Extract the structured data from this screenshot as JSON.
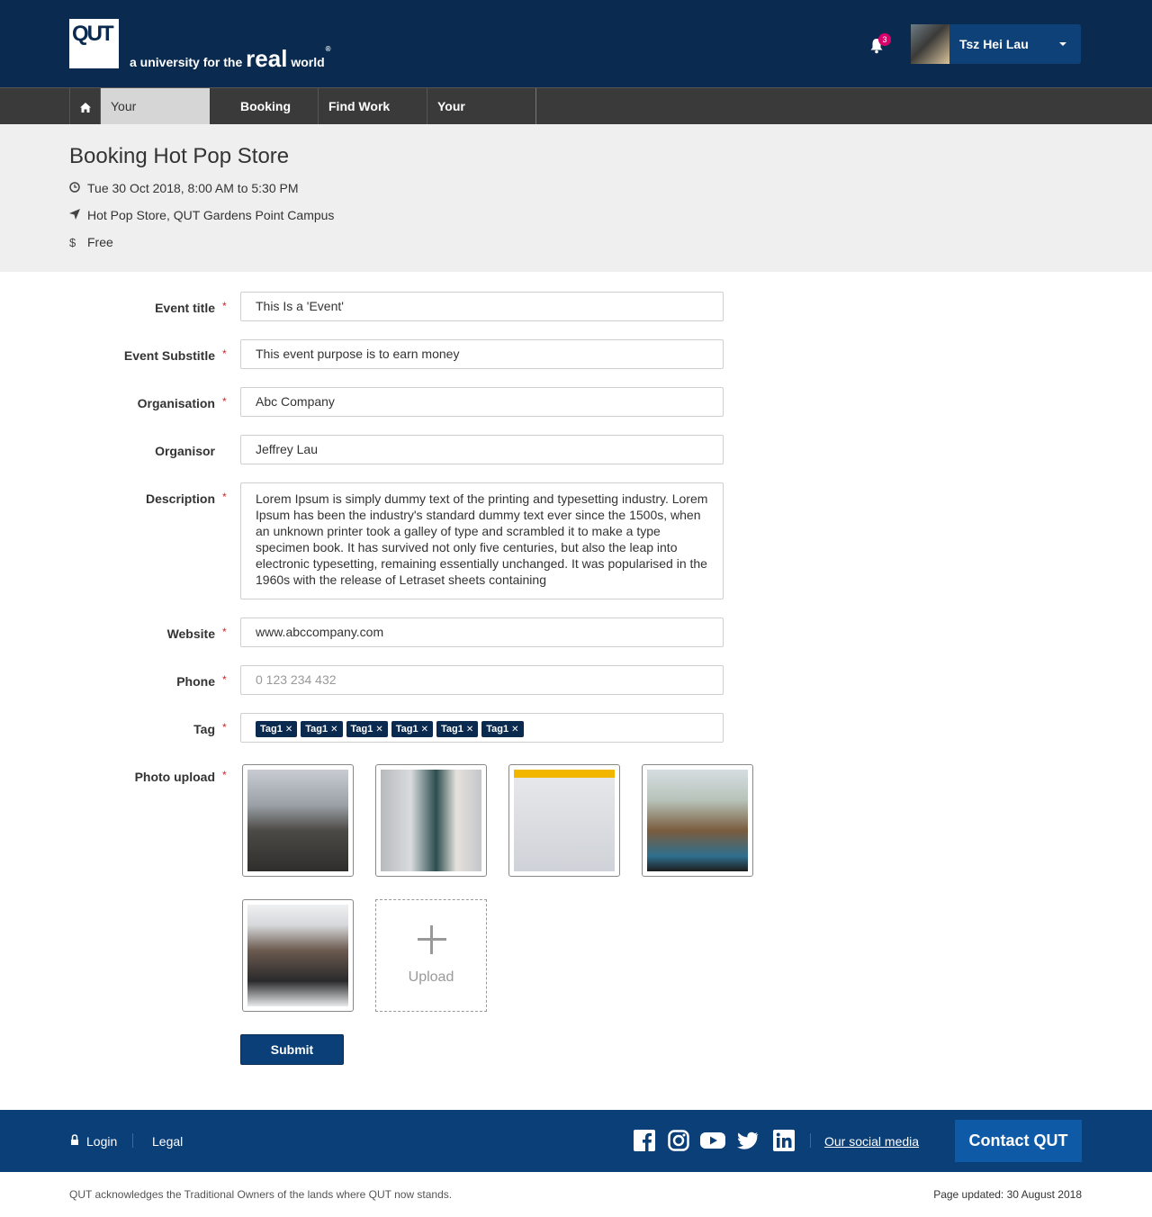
{
  "header": {
    "logo_text": "QUT",
    "tagline_prefix": "a university for the",
    "tagline_real": "real",
    "tagline_world": "world",
    "tagline_reg": "®",
    "notification_count": "3",
    "user_name": "Tsz Hei Lau"
  },
  "nav": {
    "items": [
      {
        "label": "Your Dashboard",
        "active": true
      },
      {
        "label": "Booking"
      },
      {
        "label": "Find Work"
      },
      {
        "label": "Your Dashboard"
      }
    ]
  },
  "event": {
    "title": "Booking Hot Pop Store",
    "datetime": "Tue 30 Oct 2018, 8:00 AM to 5:30 PM",
    "location": "Hot Pop Store, QUT Gardens Point Campus",
    "price": "Free"
  },
  "form": {
    "event_title": {
      "label": "Event title",
      "value": "This Is a 'Event'"
    },
    "event_substitle": {
      "label": "Event Substitle",
      "value": "This event purpose is to earn money"
    },
    "organisation": {
      "label": "Organisation",
      "value": "Abc Company"
    },
    "organisor": {
      "label": "Organisor",
      "value": "Jeffrey Lau"
    },
    "description": {
      "label": "Description",
      "value": "Lorem Ipsum is simply dummy text of the printing and typesetting industry. Lorem Ipsum has been the industry's standard dummy text ever since the 1500s, when an unknown printer took a galley of type and scrambled it to make a type specimen book. It has survived not only five centuries, but also the leap into electronic typesetting, remaining essentially unchanged. It was popularised in the 1960s with the release of Letraset sheets containing"
    },
    "website": {
      "label": "Website",
      "value": "www.abccompany.com"
    },
    "phone": {
      "label": "Phone",
      "placeholder": "0 123 234 432"
    },
    "tag": {
      "label": "Tag",
      "tags": [
        "Tag1",
        "Tag1",
        "Tag1",
        "Tag1",
        "Tag1",
        "Tag1"
      ]
    },
    "photo_upload": {
      "label": "Photo upload",
      "upload_label": "Upload"
    },
    "required_mark": "*",
    "submit_label": "Submit"
  },
  "footer": {
    "login": "Login",
    "legal": "Legal",
    "social_media": "Our social media",
    "contact": "Contact QUT",
    "acknowledgement": "QUT acknowledges the Traditional Owners of the lands where QUT now stands.",
    "page_updated": "Page updated: 30 August 2018"
  },
  "colors": {
    "header_bg": "#0a2a4f",
    "nav_bg": "#3a3a3a",
    "accent": "#0a3f78",
    "contact_btn": "#0f5aa6",
    "required": "#d21f2b",
    "badge": "#d9006c"
  }
}
